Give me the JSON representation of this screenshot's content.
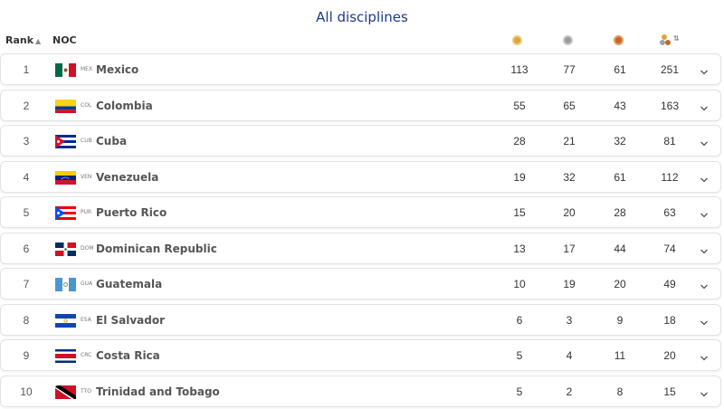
{
  "title": "All disciplines",
  "headers": {
    "rank": "Rank",
    "noc": "NOC"
  },
  "colors": {
    "gold": "#d9a441",
    "silver": "#9a9a9a",
    "bronze": "#c0692d",
    "title": "#1d3a8a"
  },
  "rows": [
    {
      "rank": "1",
      "code": "MEX",
      "name": "Mexico",
      "gold": "113",
      "silver": "77",
      "bronze": "61",
      "total": "251"
    },
    {
      "rank": "2",
      "code": "COL",
      "name": "Colombia",
      "gold": "55",
      "silver": "65",
      "bronze": "43",
      "total": "163"
    },
    {
      "rank": "3",
      "code": "CUB",
      "name": "Cuba",
      "gold": "28",
      "silver": "21",
      "bronze": "32",
      "total": "81"
    },
    {
      "rank": "4",
      "code": "VEN",
      "name": "Venezuela",
      "gold": "19",
      "silver": "32",
      "bronze": "61",
      "total": "112"
    },
    {
      "rank": "5",
      "code": "PUR",
      "name": "Puerto Rico",
      "gold": "15",
      "silver": "20",
      "bronze": "28",
      "total": "63"
    },
    {
      "rank": "6",
      "code": "DOM",
      "name": "Dominican Republic",
      "gold": "13",
      "silver": "17",
      "bronze": "44",
      "total": "74"
    },
    {
      "rank": "7",
      "code": "GUA",
      "name": "Guatemala",
      "gold": "10",
      "silver": "19",
      "bronze": "20",
      "total": "49"
    },
    {
      "rank": "8",
      "code": "ESA",
      "name": "El Salvador",
      "gold": "6",
      "silver": "3",
      "bronze": "9",
      "total": "18"
    },
    {
      "rank": "9",
      "code": "CRC",
      "name": "Costa Rica",
      "gold": "5",
      "silver": "4",
      "bronze": "11",
      "total": "20"
    },
    {
      "rank": "10",
      "code": "TTO",
      "name": "Trinidad and Tobago",
      "gold": "5",
      "silver": "2",
      "bronze": "8",
      "total": "15"
    }
  ]
}
